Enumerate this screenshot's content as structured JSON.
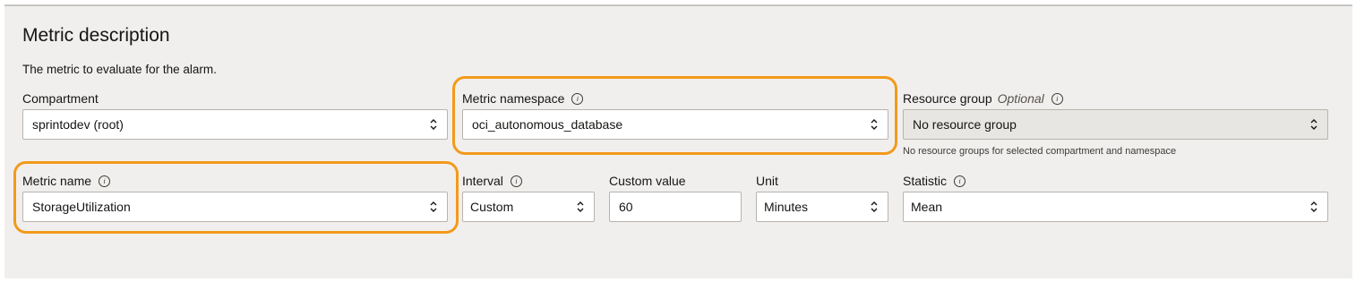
{
  "section": {
    "title": "Metric description",
    "description": "The metric to evaluate for the alarm."
  },
  "fields": {
    "compartment": {
      "label": "Compartment",
      "value": "sprintodev (root)"
    },
    "metric_namespace": {
      "label": "Metric namespace",
      "value": "oci_autonomous_database"
    },
    "resource_group": {
      "label": "Resource group",
      "optional": "Optional",
      "value": "No resource group",
      "helper": "No resource groups for selected compartment and namespace"
    },
    "metric_name": {
      "label": "Metric name",
      "value": "StorageUtilization"
    },
    "interval": {
      "label": "Interval",
      "value": "Custom"
    },
    "custom_value": {
      "label": "Custom value",
      "value": "60"
    },
    "unit": {
      "label": "Unit",
      "value": "Minutes"
    },
    "statistic": {
      "label": "Statistic",
      "value": "Mean"
    }
  },
  "icons": {
    "info": "i"
  },
  "colors": {
    "highlight": "#f29a1c",
    "panel_bg": "#f1efed"
  }
}
